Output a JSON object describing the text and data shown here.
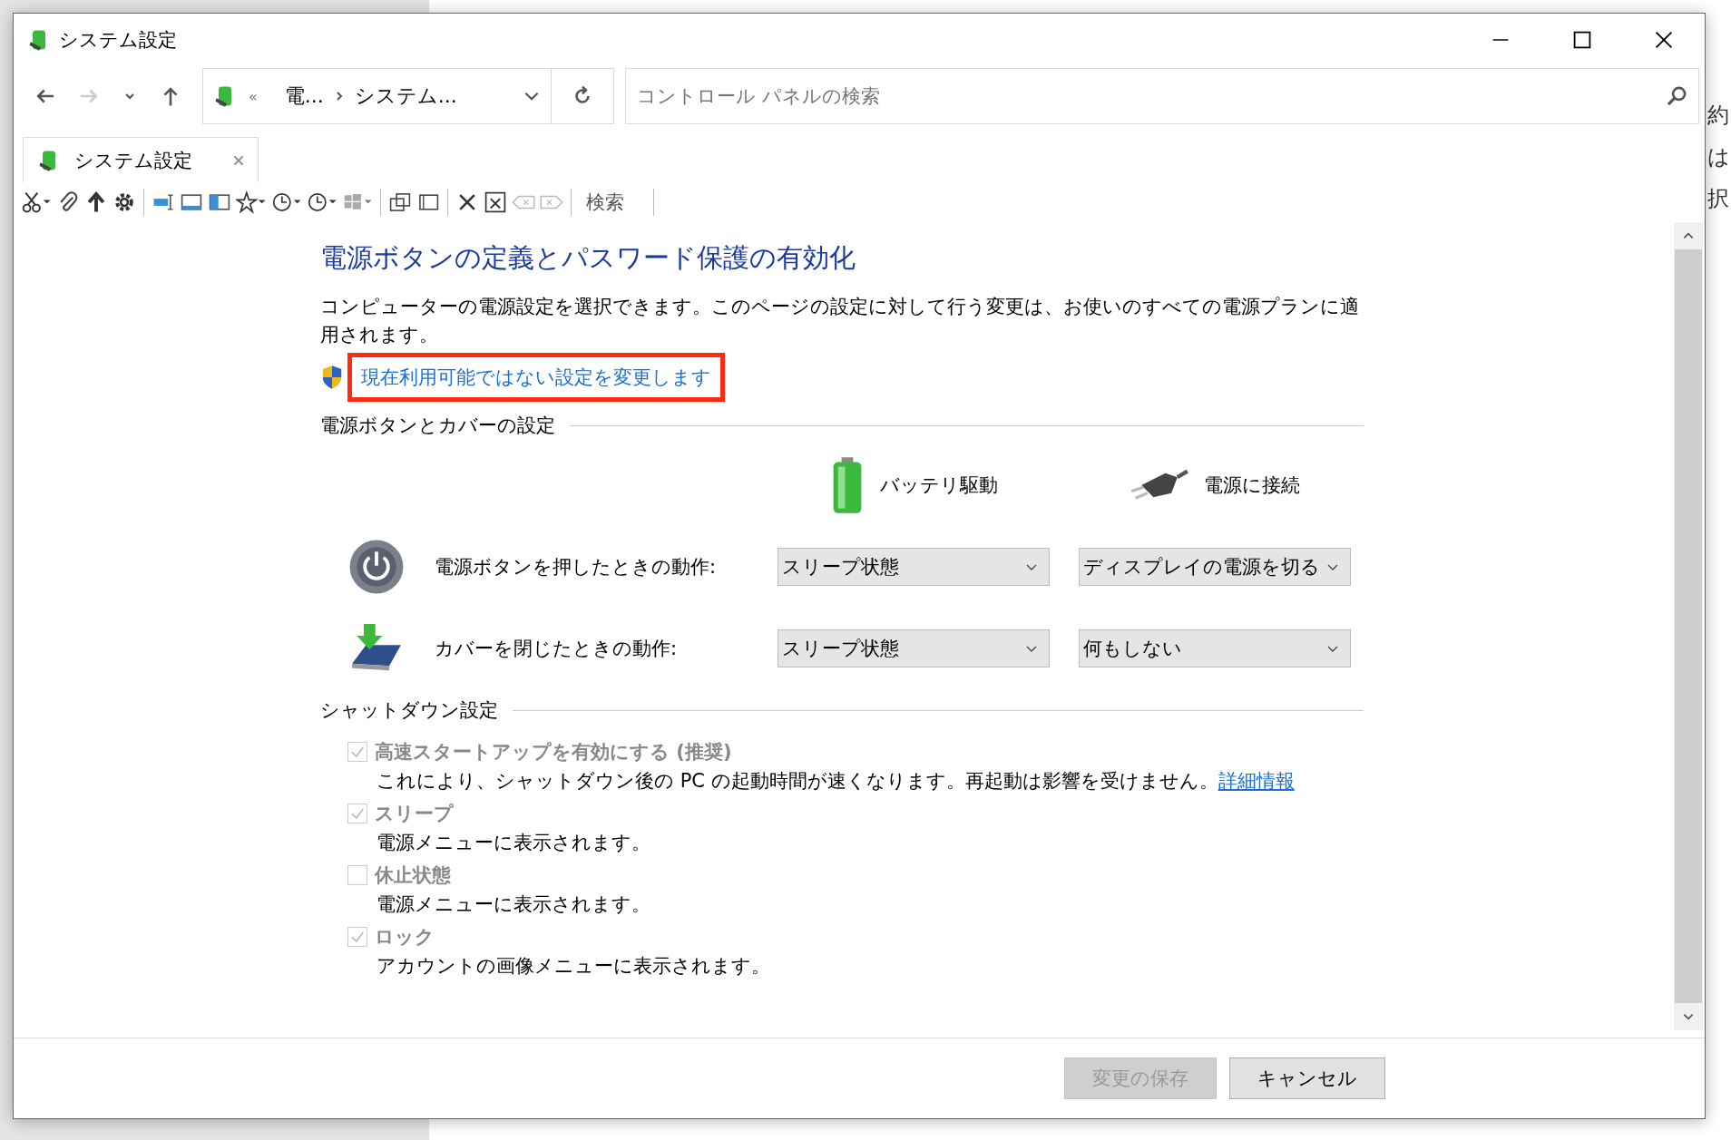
{
  "background_window": {
    "texts": [
      "約",
      "は",
      "択"
    ]
  },
  "window": {
    "title": "システム設定"
  },
  "address_bar": {
    "overflow": "«",
    "crumbs": [
      "電...",
      "システム..."
    ]
  },
  "search": {
    "placeholder": "コントロール パネルの検索"
  },
  "tabs": [
    {
      "label": "システム設定",
      "selected": true
    }
  ],
  "toolbar": {
    "search_label": "検索"
  },
  "page": {
    "heading": "電源ボタンの定義とパスワード保護の有効化",
    "description": "コンピューターの電源設定を選択できます。このページの設定に対して行う変更は、お使いのすべての電源プランに適用されます。",
    "admin_link": {
      "label": "現在利用可能ではない設定を変更します",
      "highlighted": true
    },
    "power_section": {
      "title": "電源ボタンとカバーの設定",
      "columns": [
        "バッテリ駆動",
        "電源に接続"
      ],
      "rows": [
        {
          "kind": "power",
          "label": "電源ボタンを押したときの動作:",
          "values": [
            "スリープ状態",
            "ディスプレイの電源を切る"
          ]
        },
        {
          "kind": "lid",
          "label": "カバーを閉じたときの動作:",
          "values": [
            "スリープ状態",
            "何もしない"
          ]
        }
      ]
    },
    "shutdown_section": {
      "title": "シャットダウン設定",
      "options": [
        {
          "label": "高速スタートアップを有効にする (推奨)",
          "checked": true,
          "disabled": true,
          "description": "これにより、シャットダウン後の PC の起動時間が速くなります。再起動は影響を受けません。",
          "link": "詳細情報"
        },
        {
          "label": "スリープ",
          "checked": true,
          "disabled": true,
          "description": "電源メニューに表示されます。"
        },
        {
          "label": "休止状態",
          "checked": false,
          "disabled": true,
          "description": "電源メニューに表示されます。"
        },
        {
          "label": "ロック",
          "checked": true,
          "disabled": true,
          "description": "アカウントの画像メニューに表示されます。"
        }
      ]
    }
  },
  "buttons": [
    {
      "label": "変更の保存",
      "disabled": true
    },
    {
      "label": "キャンセル",
      "disabled": false
    }
  ]
}
